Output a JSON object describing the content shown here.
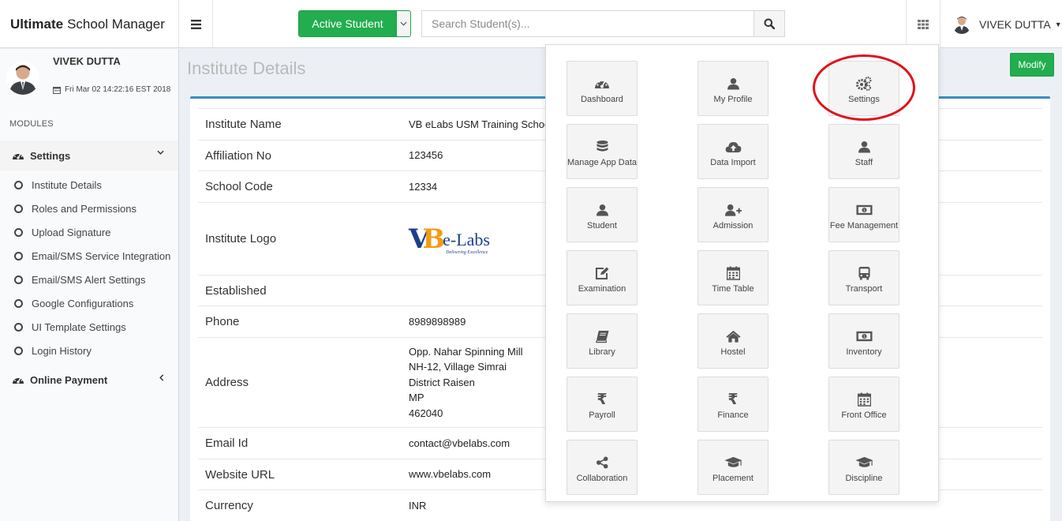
{
  "header": {
    "brand_bold": "Ultimate",
    "brand_rest": "School Manager",
    "active_button": "Active Student",
    "search_placeholder": "Search Student(s)...",
    "user_name": "VIVEK DUTTA"
  },
  "sidebar": {
    "user_name": "VIVEK DUTTA",
    "date": "Fri Mar 02 14:22:16 EST 2018",
    "modules_label": "MODULES",
    "settings_label": "Settings",
    "items": [
      {
        "label": "Institute Details"
      },
      {
        "label": "Roles and Permissions"
      },
      {
        "label": "Upload Signature"
      },
      {
        "label": "Email/SMS Service Integration"
      },
      {
        "label": "Email/SMS Alert Settings"
      },
      {
        "label": "Google Configurations"
      },
      {
        "label": "UI Template Settings"
      },
      {
        "label": "Login History"
      }
    ],
    "online_payment_label": "Online Payment"
  },
  "main": {
    "title": "Institute Details",
    "modify_label": "Modify",
    "rows": [
      {
        "key": "Institute Name",
        "value": "VB eLabs USM Training Schoo"
      },
      {
        "key": "Affiliation No",
        "value": "123456"
      },
      {
        "key": "School Code",
        "value": "12334"
      },
      {
        "key": "Institute Logo",
        "value": ""
      },
      {
        "key": "Established",
        "value": ""
      },
      {
        "key": "Phone",
        "value": "8989898989"
      },
      {
        "key": "Address",
        "lines": [
          "Opp. Nahar Spinning Mill",
          "NH-12, Village Simrai",
          "District Raisen",
          "MP",
          "462040"
        ]
      },
      {
        "key": "Email Id",
        "value": "contact@vbelabs.com"
      },
      {
        "key": "Website URL",
        "value": "www.vbelabs.com"
      },
      {
        "key": "Currency",
        "value": "INR"
      }
    ],
    "logo": {
      "text_v": "V",
      "text_b": "B",
      "text_labs": "e-Labs",
      "tagline": "Delivering Excellence"
    }
  },
  "modules_menu": {
    "tiles": [
      {
        "label": "Dashboard",
        "icon": "dashboard-icon"
      },
      {
        "label": "My Profile",
        "icon": "user-icon"
      },
      {
        "label": "Settings",
        "icon": "gears-icon"
      },
      {
        "label": "Manage App Data",
        "icon": "database-icon"
      },
      {
        "label": "Data Import",
        "icon": "cloud-upload-icon"
      },
      {
        "label": "Staff",
        "icon": "user-icon"
      },
      {
        "label": "Student",
        "icon": "user-icon"
      },
      {
        "label": "Admission",
        "icon": "user-plus-icon"
      },
      {
        "label": "Fee Management",
        "icon": "money-icon"
      },
      {
        "label": "Examination",
        "icon": "edit-icon"
      },
      {
        "label": "Time Table",
        "icon": "calendar-icon"
      },
      {
        "label": "Transport",
        "icon": "bus-icon"
      },
      {
        "label": "Library",
        "icon": "book-icon"
      },
      {
        "label": "Hostel",
        "icon": "home-icon"
      },
      {
        "label": "Inventory",
        "icon": "money-icon"
      },
      {
        "label": "Payroll",
        "icon": "rupee-icon"
      },
      {
        "label": "Finance",
        "icon": "rupee-icon"
      },
      {
        "label": "Front Office",
        "icon": "calendar-icon"
      },
      {
        "label": "Collaboration",
        "icon": "share-icon"
      },
      {
        "label": "Placement",
        "icon": "graduation-cap-icon"
      },
      {
        "label": "Discipline",
        "icon": "graduation-cap-icon"
      }
    ],
    "highlight_color": "#e0121b"
  },
  "colors": {
    "accent_green": "#22ad4f",
    "panel_border": "#3c8dbc",
    "icon_gray": "#555555"
  }
}
